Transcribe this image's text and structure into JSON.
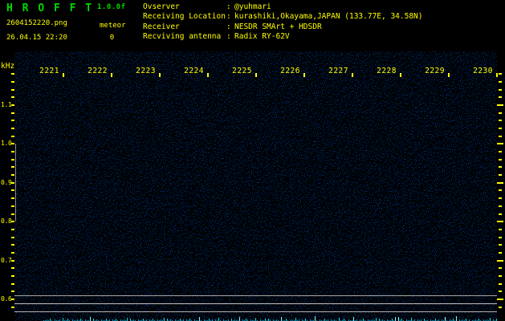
{
  "app": {
    "title": "H R O F F T",
    "version": "1.0.0f",
    "filename": "2604152220.png",
    "meteor_label": "meteor",
    "meteor_count": "0",
    "datetime": "26.04.15 22:20"
  },
  "info": {
    "separator": ":",
    "rows": [
      {
        "label": "Ovserver",
        "value": "@yuhmari"
      },
      {
        "label": "Receiving Location",
        "value": "kurashiki,Okayama,JAPAN (133.77E, 34.58N)"
      },
      {
        "label": "Receiver",
        "value": "NESDR SMArt + HDSDR"
      },
      {
        "label": "Recviving antenna",
        "value": "Radix RY-62V"
      }
    ]
  },
  "chart_data": {
    "type": "heatmap",
    "title": "HROFFT meteor echo spectrogram 2220-2230",
    "x_axis": {
      "ticks": [
        "2221",
        "2222",
        "2223",
        "2224",
        "2225",
        "2226",
        "2227",
        "2228",
        "2229",
        "2230"
      ]
    },
    "y_axis": {
      "label": "kHz",
      "ticks": [
        "1.1",
        "1.0",
        "0.9",
        "0.8",
        "0.7",
        "0.6"
      ],
      "range_khz": [
        0.58,
        1.18
      ],
      "minor_step_khz": 0.02
    },
    "carrier_lines_khz": [
      0.61,
      0.59,
      0.57
    ],
    "reference_bar_khz": [
      1.0,
      0.8
    ],
    "meteor_echoes": [],
    "background": "sparse dark-blue noise speckle on black"
  },
  "signal_trace": {
    "heights": "0112131021120411310211213102115031210211312021310212140312102113120213102121403121021131202131021151021131202141021120312115021320211410211313202121051131021141202131021161021131202121041131021151202131021121403121021131505231021141202120311021131202151021316021213020112131021214021300"
  },
  "colors": {
    "yellow": "#ffff00",
    "green": "#00d800",
    "gray_line_1": "#a8a8a8",
    "gray_line_2": "#c4c4c4",
    "gray_line_3": "#b4b4b4",
    "reference_bar": "#8c8c8c",
    "trace_dim": "#00a0c8",
    "trace_mid": "#00dce8",
    "trace_bright": "#7affff"
  }
}
